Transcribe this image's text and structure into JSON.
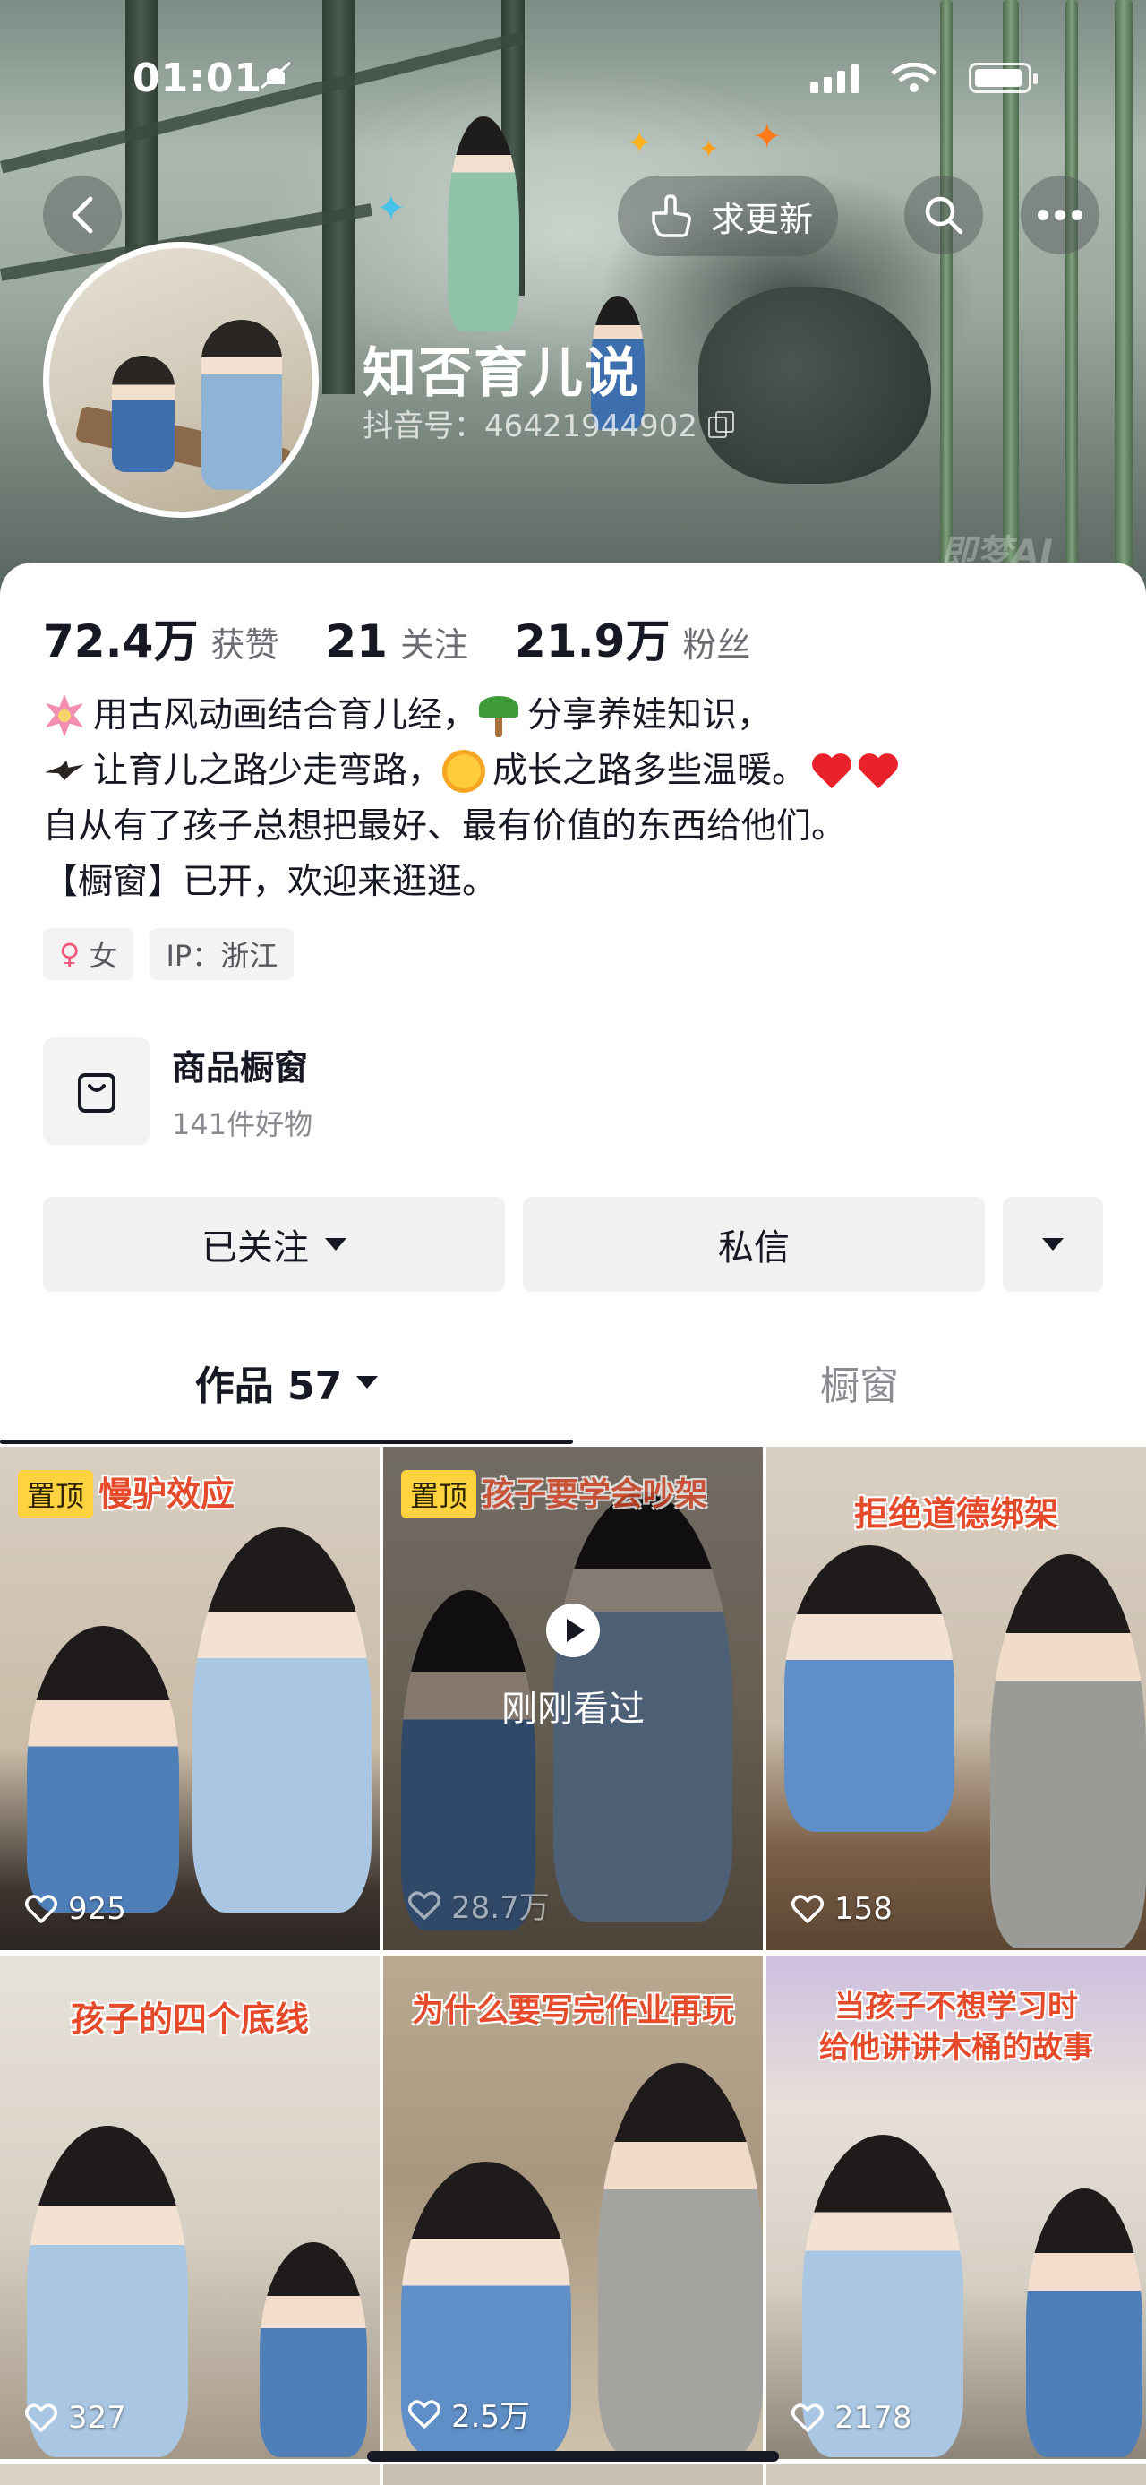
{
  "status_bar": {
    "time": "01:01"
  },
  "header": {
    "update_button_label": "求更新",
    "profile_name": "知否育儿说",
    "douyin_id": "抖音号：46421944902",
    "watermark": "即梦AI"
  },
  "stats": [
    {
      "value": "72.4万",
      "label": "获赞"
    },
    {
      "value": "21",
      "label": "关注"
    },
    {
      "value": "21.9万",
      "label": "粉丝"
    }
  ],
  "bio": {
    "line1a": "用古风动画结合育儿经，",
    "line1b": "分享养娃知识，",
    "line2a": "让育儿之路少走弯路，",
    "line2b": "成长之路多些温暖。",
    "line3": "自从有了孩子总想把最好、最有价值的东西给他们。",
    "line4": "【橱窗】已开，欢迎来逛逛。"
  },
  "tags": {
    "gender": "女",
    "ip": "IP：浙江"
  },
  "shop": {
    "title": "商品橱窗",
    "subtitle": "141件好物"
  },
  "actions": {
    "follow_label": "已关注",
    "message_label": "私信"
  },
  "tabs": {
    "works_label": "作品 57",
    "shop_label": "橱窗"
  },
  "videos": [
    {
      "title": "慢驴效应",
      "likes": "925",
      "pinned": "置顶"
    },
    {
      "title": "孩子要学会吵架",
      "likes": "28.7万",
      "pinned": "置顶",
      "overlay": "刚刚看过"
    },
    {
      "title": "拒绝道德绑架",
      "likes": "158"
    },
    {
      "title": "孩子的四个底线",
      "likes": "327"
    },
    {
      "title": "为什么要写完作业再玩",
      "likes": "2.5万"
    },
    {
      "title_line1": "当孩子不想学习时",
      "title_line2": "给他讲讲木桶的故事",
      "likes": "2178"
    }
  ]
}
